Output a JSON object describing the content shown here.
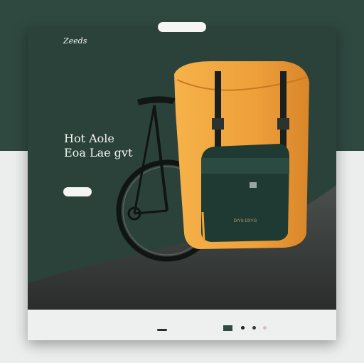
{
  "search": {
    "label": ""
  },
  "brand": {
    "logo": "Zeeds"
  },
  "nav": {
    "items": [
      "",
      "",
      "",
      "",
      "",
      "",
      "",
      "",
      ""
    ]
  },
  "hero": {
    "eyebrow": "",
    "headline_line1": "Hot Aole",
    "headline_line2": "Eoa Lae gvt",
    "body": "",
    "cta": ""
  },
  "product": {
    "pouch_label": "DIYS DXYG"
  },
  "footer": {
    "link_a": "",
    "link_b": ""
  },
  "colors": {
    "page_top": "#2f4840",
    "frame_bg": "#2b423a",
    "bag_orange": "#f1a43a",
    "pouch_green": "#1f3a32",
    "footer_bg": "#eef0ef"
  }
}
